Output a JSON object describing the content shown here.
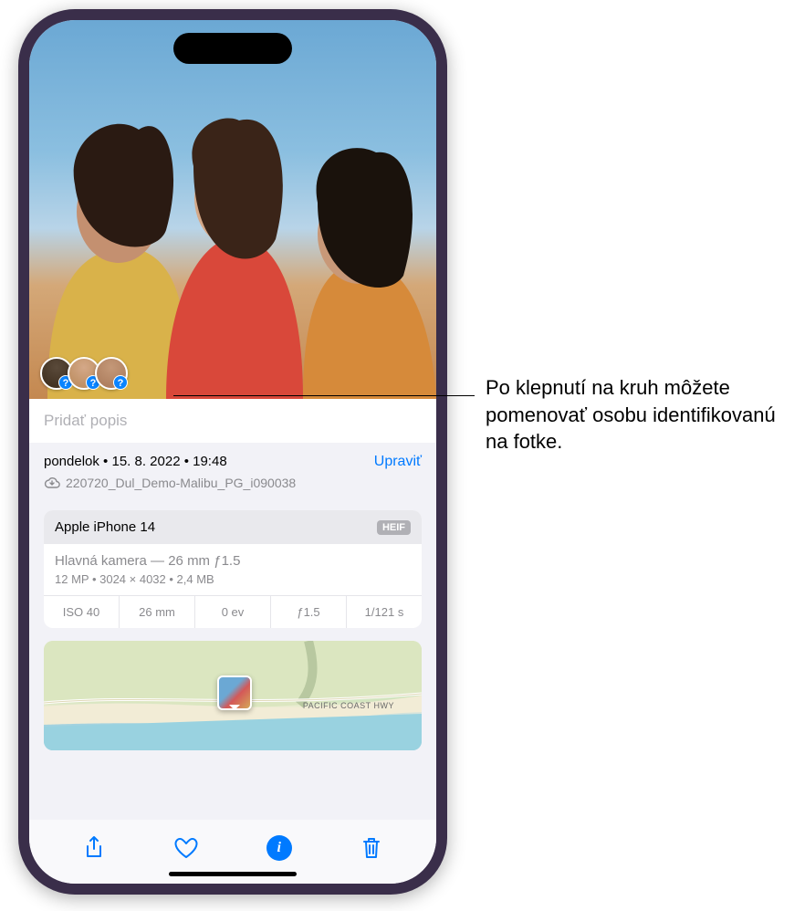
{
  "photo": {
    "caption_placeholder": "Pridať popis",
    "face_badges": [
      "?",
      "?",
      "?"
    ]
  },
  "meta": {
    "date_line": "pondelok • 15. 8. 2022 • 19:48",
    "edit_label": "Upraviť",
    "filename": "220720_Dul_Demo-Malibu_PG_i090038"
  },
  "camera": {
    "device": "Apple iPhone 14",
    "format_badge": "HEIF",
    "lens": "Hlavná kamera — 26 mm ƒ1.5",
    "detail": "12 MP  •  3024 × 4032  •  2,4 MB",
    "exif": {
      "iso": "ISO 40",
      "focal": "26 mm",
      "ev": "0 ev",
      "aperture": "ƒ1.5",
      "shutter": "1/121 s"
    }
  },
  "map": {
    "road_label": "PACIFIC COAST HWY"
  },
  "toolbar": {
    "share": "share",
    "favorite": "favorite",
    "info": "info",
    "trash": "trash"
  },
  "callout": {
    "text": "Po klepnutí na kruh môžete pomenovať osobu identifikovanú na fotke."
  }
}
